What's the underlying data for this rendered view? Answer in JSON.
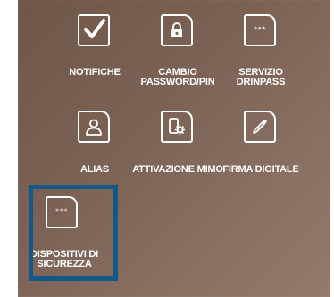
{
  "tiles": [
    {
      "label": "NOTIFICHE",
      "icon": "checkbox-icon"
    },
    {
      "label": "CAMBIO\nPASSWORD/PIN",
      "icon": "lock-icon"
    },
    {
      "label": "SERVIZIO\nDRINPASS",
      "icon": "password-field-icon"
    },
    {
      "label": "ALIAS",
      "icon": "user-icon"
    },
    {
      "label": "ATTIVAZIONE MIMO",
      "icon": "device-settings-icon"
    },
    {
      "label": "FIRMA DIGITALE",
      "icon": "pen-nib-icon"
    },
    {
      "label": "DISPOSITIVI DI\nSICUREZZA",
      "icon": "password-field-icon",
      "selected": true
    }
  ],
  "mask_text": "***",
  "colors": {
    "panel_background": "#7b6254",
    "selection_border": "#0f5a86",
    "icon_and_text": "#ffffff"
  }
}
